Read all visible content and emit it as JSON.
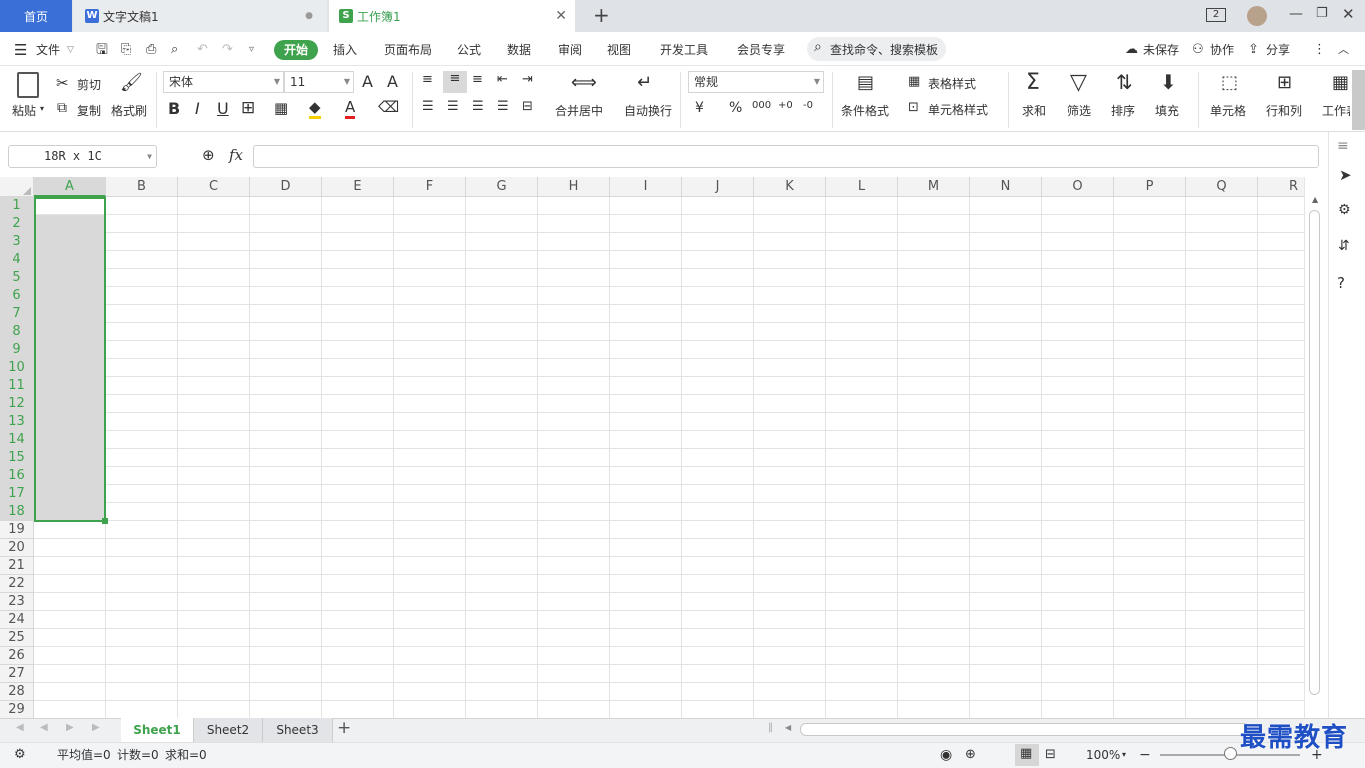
{
  "tabs": {
    "home": "首页",
    "doc": "文字文稿1",
    "book": "工作簿1",
    "doc_icon": "W",
    "book_icon": "S",
    "badge": "2"
  },
  "menu": {
    "file": "文件",
    "start": "开始",
    "insert": "插入",
    "layout": "页面布局",
    "formula": "公式",
    "data": "数据",
    "review": "审阅",
    "view": "视图",
    "dev": "开发工具",
    "member": "会员专享",
    "search": "查找命令、搜索模板",
    "unsaved": "未保存",
    "collab": "协作",
    "share": "分享"
  },
  "ribbon": {
    "paste": "粘贴",
    "cut": "剪切",
    "copy": "复制",
    "format_painter": "格式刷",
    "font": "宋体",
    "size": "11",
    "merge": "合并居中",
    "wrap": "自动换行",
    "numfmt": "常规",
    "cond": "条件格式",
    "table_style": "表格样式",
    "cell_style": "单元格样式",
    "sum": "求和",
    "filter": "筛选",
    "sort": "排序",
    "fill": "填充",
    "cell": "单元格",
    "rowcol": "行和列",
    "worksheet": "工作表",
    "bold": "B",
    "italic": "I",
    "underline": "U",
    "currency": "¥",
    "percent": "%",
    "thousands": "000",
    "dec_inc": "+0",
    "dec_dec": "-0",
    "font_grow": "A",
    "font_shrink": "A",
    "font_color": "A"
  },
  "formula": {
    "namebox": "18R x 1C",
    "fx": "fx"
  },
  "columns": [
    "A",
    "B",
    "C",
    "D",
    "E",
    "F",
    "G",
    "H",
    "I",
    "J",
    "K",
    "L",
    "M",
    "N",
    "O",
    "P",
    "Q",
    "R"
  ],
  "rows": [
    "1",
    "2",
    "3",
    "4",
    "5",
    "6",
    "7",
    "8",
    "9",
    "10",
    "11",
    "12",
    "13",
    "14",
    "15",
    "16",
    "17",
    "18",
    "19",
    "20",
    "21",
    "22",
    "23",
    "24",
    "25",
    "26",
    "27",
    "28",
    "29"
  ],
  "sheets": [
    "Sheet1",
    "Sheet2",
    "Sheet3"
  ],
  "status": {
    "avg": "平均值=0",
    "count": "计数=0",
    "sum": "求和=0",
    "zoom": "100%"
  },
  "watermark": "最需教育",
  "colors": {
    "accent": "#3fa34d",
    "home": "#3a6fd8",
    "selection": "#d9d9d9"
  }
}
